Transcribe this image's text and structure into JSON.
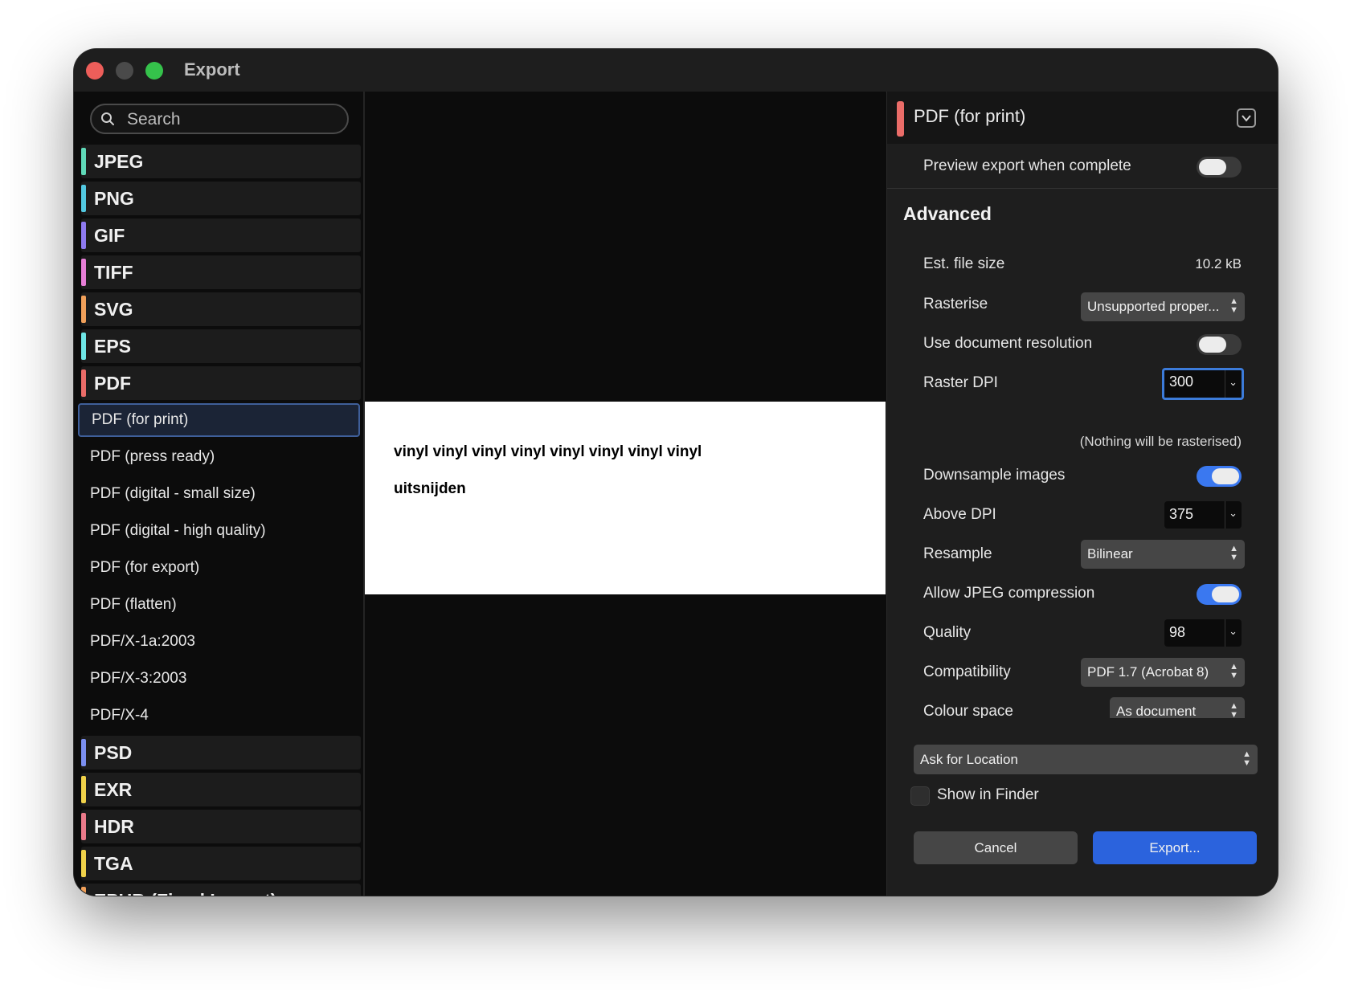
{
  "window": {
    "title": "Export"
  },
  "search": {
    "placeholder": "Search"
  },
  "formats": [
    {
      "type": "category",
      "label": "JPEG",
      "color": "#5fd9b8"
    },
    {
      "type": "category",
      "label": "PNG",
      "color": "#52c8e0"
    },
    {
      "type": "category",
      "label": "GIF",
      "color": "#8e7af0"
    },
    {
      "type": "category",
      "label": "TIFF",
      "color": "#e77ed6"
    },
    {
      "type": "category",
      "label": "SVG",
      "color": "#f0a05a"
    },
    {
      "type": "category",
      "label": "EPS",
      "color": "#6ee6e6"
    },
    {
      "type": "category",
      "label": "PDF",
      "color": "#ea6c68"
    },
    {
      "type": "preset",
      "label": "PDF (for print)",
      "selected": true
    },
    {
      "type": "preset",
      "label": "PDF (press ready)"
    },
    {
      "type": "preset",
      "label": "PDF (digital - small size)"
    },
    {
      "type": "preset",
      "label": "PDF (digital - high quality)"
    },
    {
      "type": "preset",
      "label": "PDF (for export)"
    },
    {
      "type": "preset",
      "label": "PDF (flatten)"
    },
    {
      "type": "preset",
      "label": "PDF/X-1a:2003"
    },
    {
      "type": "preset",
      "label": "PDF/X-3:2003"
    },
    {
      "type": "preset",
      "label": "PDF/X-4"
    },
    {
      "type": "category",
      "label": "PSD",
      "color": "#7b8ff0"
    },
    {
      "type": "category",
      "label": "EXR",
      "color": "#f0d24a"
    },
    {
      "type": "category",
      "label": "HDR",
      "color": "#ea7a8a"
    },
    {
      "type": "category",
      "label": "TGA",
      "color": "#f0d24a"
    },
    {
      "type": "category",
      "label": "EPUB (Fixed Layout)",
      "color": "#f0a05a"
    }
  ],
  "preview": {
    "line1": "vinyl vinyl vinyl vinyl vinyl vinyl vinyl vinyl",
    "line2": "uitsnijden"
  },
  "panel": {
    "preset_name": "PDF (for print)",
    "preset_color": "#ea6c68",
    "preview_when_complete": {
      "label": "Preview export when complete",
      "on": false
    },
    "advanced_title": "Advanced",
    "est_file_size": {
      "label": "Est. file size",
      "value": "10.2 kB"
    },
    "rasterise": {
      "label": "Rasterise",
      "value": "Unsupported proper..."
    },
    "use_doc_resolution": {
      "label": "Use document resolution",
      "on": false
    },
    "raster_dpi": {
      "label": "Raster DPI",
      "value": "300"
    },
    "raster_note": "(Nothing will be rasterised)",
    "downsample": {
      "label": "Downsample images",
      "on": true
    },
    "above_dpi": {
      "label": "Above DPI",
      "value": "375"
    },
    "resample": {
      "label": "Resample",
      "value": "Bilinear"
    },
    "jpeg_compression": {
      "label": "Allow JPEG compression",
      "on": true
    },
    "quality": {
      "label": "Quality",
      "value": "98"
    },
    "compatibility": {
      "label": "Compatibility",
      "value": "PDF 1.7 (Acrobat 8)"
    },
    "colour_space": {
      "label": "Colour space",
      "value": "As document"
    }
  },
  "footer": {
    "location": "Ask for Location",
    "show_in_finder": {
      "label": "Show in Finder",
      "checked": false
    },
    "cancel": "Cancel",
    "export": "Export..."
  },
  "icons": {
    "search": "magnifier-icon",
    "collapse": "chevron-down-icon",
    "updown": "updown-arrows-icon"
  }
}
